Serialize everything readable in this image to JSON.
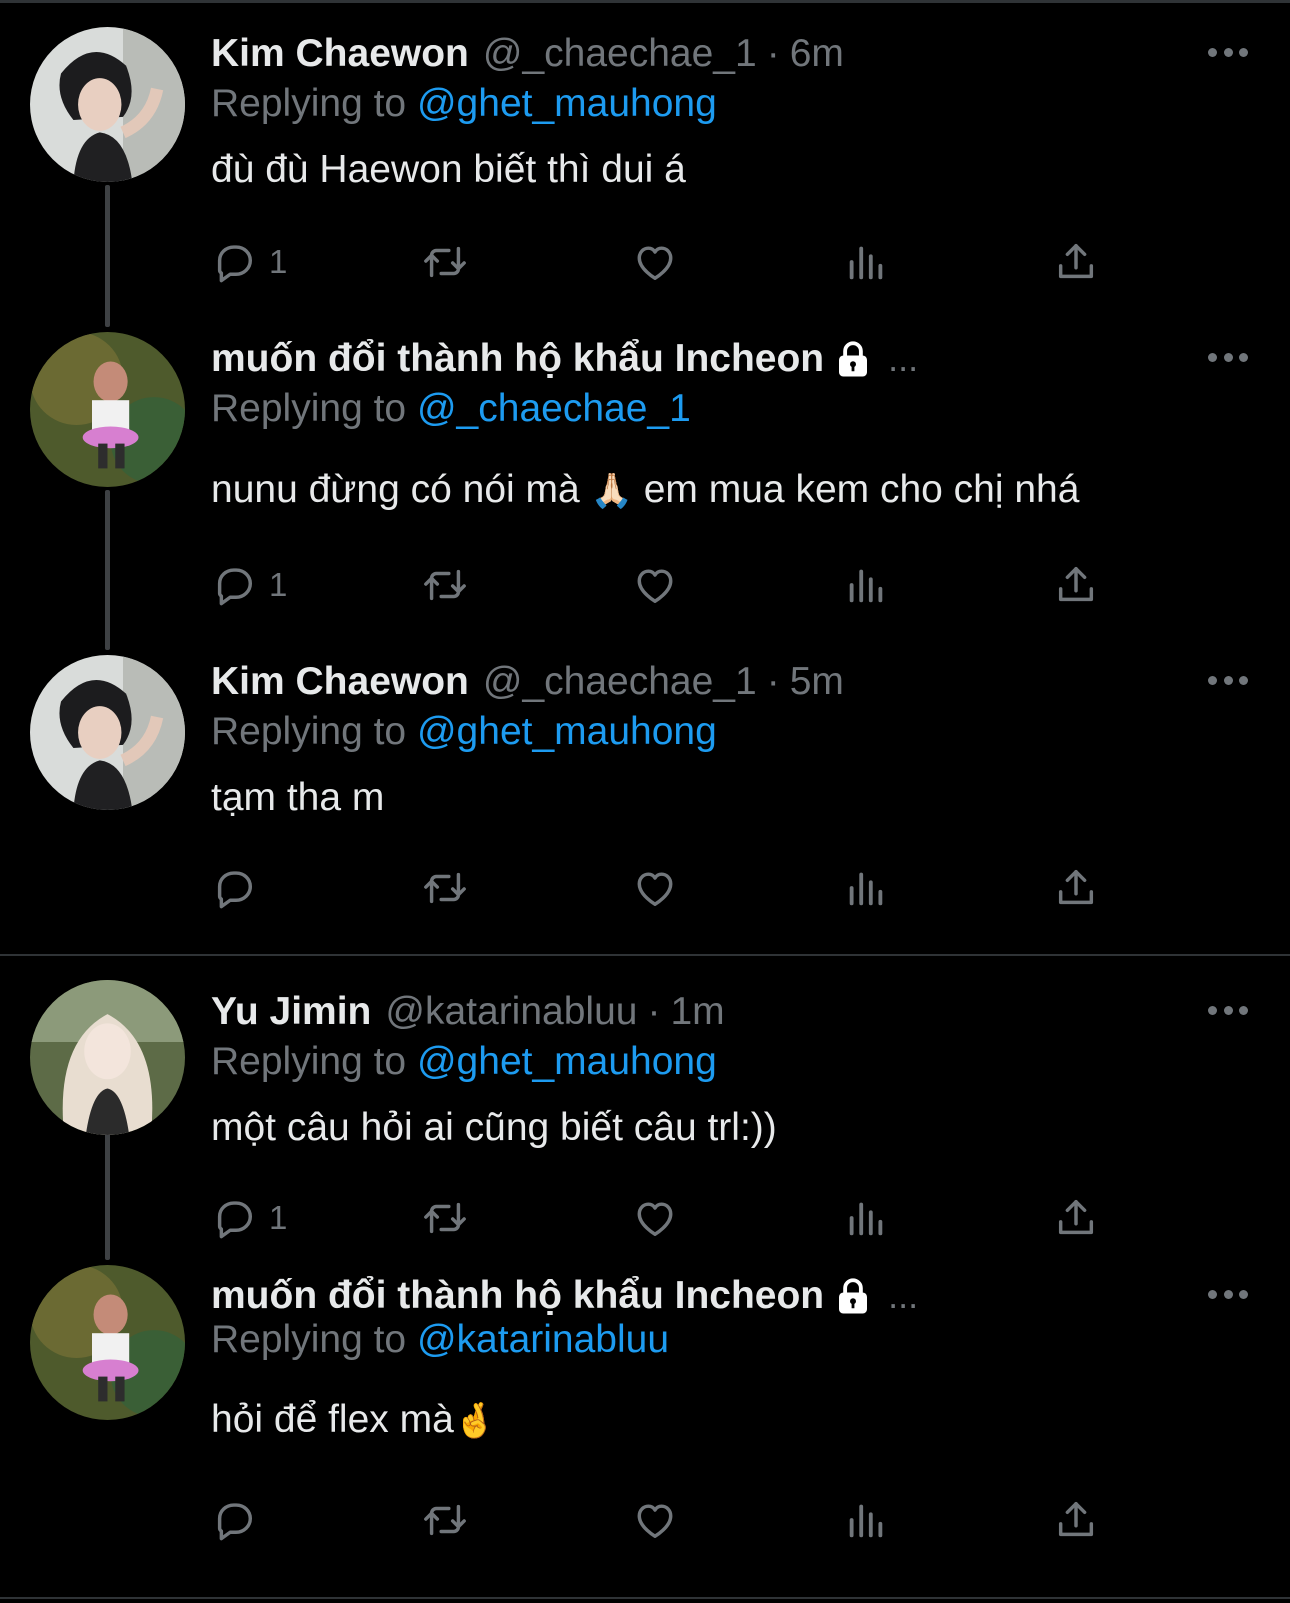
{
  "tweets": [
    {
      "name": "Kim Chaewon",
      "handle": "@_chaechae_1",
      "dot": "·",
      "time": "6m",
      "reply_prefix": "Replying to",
      "reply_to": "@ghet_mauhong",
      "text": "đù đù Haewon biết thì dui á",
      "reply_count": "1"
    },
    {
      "name": " muốn đổi thành hộ khẩu Incheon",
      "ellipsis": "...",
      "reply_prefix": "Replying to",
      "reply_to": "@_chaechae_1",
      "text_before": "nunu đừng có nói mà",
      "emoji": "🙏🏻",
      "text_after": " em mua kem cho chị nhá",
      "reply_count": "1"
    },
    {
      "name": "Kim Chaewon",
      "handle": "@_chaechae_1",
      "dot": "·",
      "time": "5m",
      "reply_prefix": "Replying to",
      "reply_to": "@ghet_mauhong",
      "text": "tạm tha m",
      "reply_count": ""
    },
    {
      "name": "Yu Jimin",
      "handle": "@katarinabluu",
      "dot": "·",
      "time": "1m",
      "reply_prefix": "Replying to",
      "reply_to": "@ghet_mauhong",
      "text": "một câu hỏi ai cũng biết câu trl:))",
      "reply_count": "1"
    },
    {
      "name": " muốn đổi thành hộ khẩu Incheon",
      "ellipsis": "...",
      "reply_prefix": "Replying to",
      "reply_to": "@katarinabluu",
      "text": "hỏi để flex mà",
      "emoji": "🤞",
      "reply_count": ""
    }
  ],
  "icons": {
    "reply": "reply-icon",
    "retweet": "retweet-icon",
    "like": "like-icon",
    "views": "views-icon",
    "share": "share-icon",
    "more": "more-icon",
    "lock": "lock-icon"
  },
  "colors": {
    "background": "#000000",
    "text": "#e7e9ea",
    "muted": "#71767b",
    "link": "#1d9bf0",
    "divider": "#2f3336"
  }
}
